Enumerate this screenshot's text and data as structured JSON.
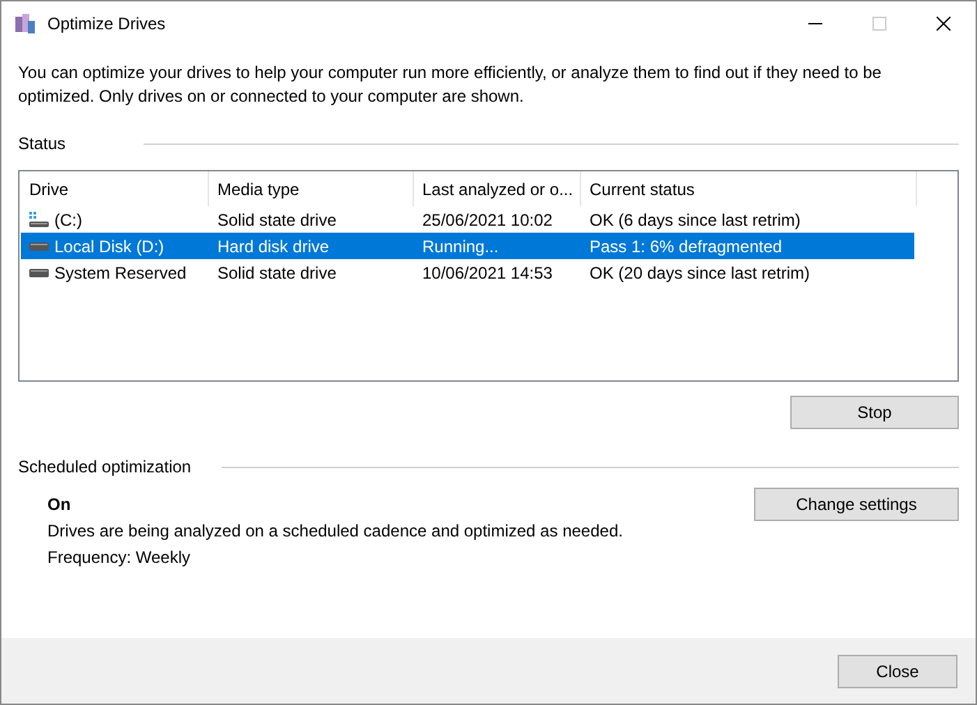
{
  "window": {
    "title": "Optimize Drives",
    "maximize_disabled": true
  },
  "intro": "You can optimize your drives to help your computer run more efficiently, or analyze them to find out if they need to be optimized. Only drives on or connected to your computer are shown.",
  "status": {
    "heading": "Status",
    "columns": [
      "Drive",
      "Media type",
      "Last analyzed or o...",
      "Current status"
    ],
    "rows": [
      {
        "kind": "system",
        "drive": "(C:)",
        "media_type": "Solid state drive",
        "last_analyzed": "25/06/2021 10:02",
        "current_status": "OK (6 days since last retrim)",
        "selected": false
      },
      {
        "kind": "disk",
        "drive": "Local Disk (D:)",
        "media_type": "Hard disk drive",
        "last_analyzed": "Running...",
        "current_status": "Pass 1: 6% defragmented",
        "selected": true
      },
      {
        "kind": "disk",
        "drive": "System Reserved",
        "media_type": "Solid state drive",
        "last_analyzed": "10/06/2021 14:53",
        "current_status": "OK (20 days since last retrim)",
        "selected": false
      }
    ],
    "action_button": "Stop"
  },
  "scheduled": {
    "heading": "Scheduled optimization",
    "state": "On",
    "description": "Drives are being analyzed on a scheduled cadence and optimized as needed.",
    "frequency": "Frequency: Weekly",
    "button": "Change settings"
  },
  "footer": {
    "button": "Close"
  }
}
